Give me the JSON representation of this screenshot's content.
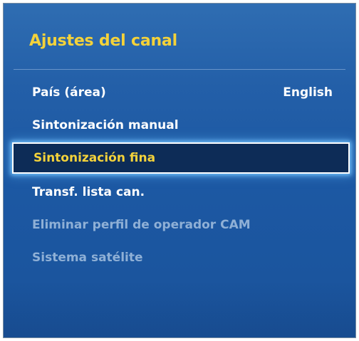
{
  "menu": {
    "title": "Ajustes del canal",
    "items": [
      {
        "label": "País (área)",
        "value": "English",
        "state": "normal"
      },
      {
        "label": "Sintonización manual",
        "value": "",
        "state": "normal"
      },
      {
        "label": "Sintonización fina",
        "value": "",
        "state": "selected"
      },
      {
        "label": "Transf. lista can.",
        "value": "",
        "state": "normal"
      },
      {
        "label": "Eliminar perfil de operador CAM",
        "value": "",
        "state": "disabled"
      },
      {
        "label": "Sistema satélite",
        "value": "",
        "state": "disabled"
      }
    ]
  },
  "colors": {
    "title": "#f4d23a",
    "selected_text": "#f4d23a",
    "normal_text": "#ffffff",
    "disabled_text": "#8fb0d6",
    "panel_bg": "#1c58a3",
    "selected_bg": "#0d2c57"
  }
}
